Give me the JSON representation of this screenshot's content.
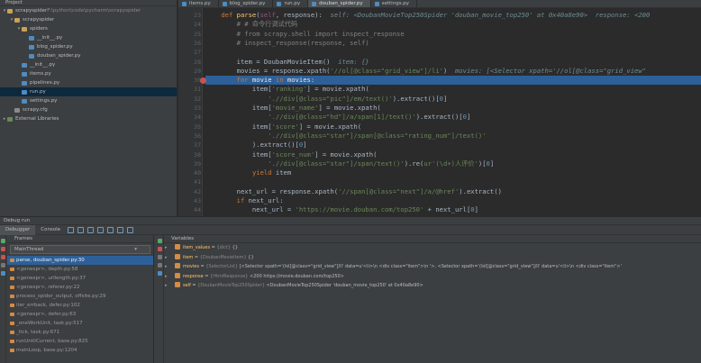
{
  "project": {
    "header": "Project",
    "tree": [
      {
        "label": "scrapyspider",
        "suffix": " F:\\python\\code\\pycharm\\scrapyspider",
        "kind": "folder",
        "indent": 0,
        "arrow": "▾"
      },
      {
        "label": "scrapyspider",
        "kind": "folder",
        "indent": 1,
        "arrow": "▾"
      },
      {
        "label": "spiders",
        "kind": "folder",
        "indent": 2,
        "arrow": "▾"
      },
      {
        "label": "__init__.py",
        "kind": "py",
        "indent": 3,
        "arrow": ""
      },
      {
        "label": "blog_spider.py",
        "kind": "py",
        "indent": 3,
        "arrow": ""
      },
      {
        "label": "douban_spider.py",
        "kind": "py",
        "indent": 3,
        "arrow": ""
      },
      {
        "label": "__init__.py",
        "kind": "py",
        "indent": 2,
        "arrow": ""
      },
      {
        "label": "items.py",
        "kind": "py",
        "indent": 2,
        "arrow": ""
      },
      {
        "label": "pipelines.py",
        "kind": "py",
        "indent": 2,
        "arrow": ""
      },
      {
        "label": "run.py",
        "kind": "py",
        "indent": 2,
        "arrow": "",
        "selected": true
      },
      {
        "label": "settings.py",
        "kind": "py",
        "indent": 2,
        "arrow": ""
      },
      {
        "label": "scrapy.cfg",
        "kind": "cfg",
        "indent": 1,
        "arrow": ""
      },
      {
        "label": "External Libraries",
        "kind": "lib",
        "indent": 0,
        "arrow": "▸"
      }
    ]
  },
  "editor": {
    "tabs": [
      {
        "label": "items.py"
      },
      {
        "label": "blog_spider.py"
      },
      {
        "label": "run.py"
      },
      {
        "label": "douban_spider.py",
        "active": true
      },
      {
        "label": "settings.py"
      }
    ],
    "highlight_line": 30,
    "breakpoint_line": 30,
    "lines": [
      {
        "n": "23",
        "html": "    <span class=\"kw\">def</span> <span class=\"fn\">parse</span>(<span class=\"sf\">self</span>, response):  <span class=\"inl\">self: &lt;DoubanMovieTop250Spider 'douban_movie_top250' at 0x40a8e90&gt;  response: &lt;200</span>"
      },
      {
        "n": "24",
        "html": "        <span class=\"cm\"># # 命令行调试代码</span>"
      },
      {
        "n": "25",
        "html": "        <span class=\"cm\"># from scrapy.shell import inspect_response</span>"
      },
      {
        "n": "26",
        "html": "        <span class=\"cm\"># inspect_response(response, self)</span>"
      },
      {
        "n": "27",
        "html": ""
      },
      {
        "n": "28",
        "html": "        item = DoubanMovieItem()  <span class=\"inl\">item: {}</span>"
      },
      {
        "n": "29",
        "html": "        movies = response.xpath(<span class=\"st\">'//ol[@class=\"grid_view\"]/li'</span>)  <span class=\"inl\">movies: [&lt;Selector xpath='//ol[@class=\"grid_view\"</span>"
      },
      {
        "n": "30",
        "html": "        <span class=\"kw\">for</span> movie <span class=\"kw\">in</span> movies:"
      },
      {
        "n": "31",
        "html": "            item[<span class=\"st\">'ranking'</span>] = movie.xpath("
      },
      {
        "n": "32",
        "html": "                <span class=\"st\">'.//div[@class=\"pic\"]/em/text()'</span>).extract()[<span class=\"nm\">0</span>]"
      },
      {
        "n": "33",
        "html": "            item[<span class=\"st\">'movie_name'</span>] = movie.xpath("
      },
      {
        "n": "34",
        "html": "                <span class=\"st\">'.//div[@class=\"hd\"]/a/span[1]/text()'</span>).extract()[<span class=\"nm\">0</span>]"
      },
      {
        "n": "35",
        "html": "            item[<span class=\"st\">'score'</span>] = movie.xpath("
      },
      {
        "n": "36",
        "html": "                <span class=\"st\">'.//div[@class=\"star\"]/span[@class=\"rating_num\"]/text()'</span>"
      },
      {
        "n": "37",
        "html": "            ).extract()[<span class=\"nm\">0</span>]"
      },
      {
        "n": "38",
        "html": "            item[<span class=\"st\">'score_num'</span>] = movie.xpath("
      },
      {
        "n": "39",
        "html": "                <span class=\"st\">'.//div[@class=\"star\"]/span/text()'</span>).re(<span class=\"st\">ur'(\\d+)人评价'</span>)[<span class=\"nm\">0</span>]"
      },
      {
        "n": "40",
        "html": "            <span class=\"kw\">yield</span> item"
      },
      {
        "n": "41",
        "html": ""
      },
      {
        "n": "42",
        "html": "        next_url = response.xpath(<span class=\"st\">'//span[@class=\"next\"]/a/@href'</span>).extract()"
      },
      {
        "n": "43",
        "html": "        <span class=\"kw\">if</span> next_url:"
      },
      {
        "n": "44",
        "html": "            next_url = <span class=\"st\">'https://movie.douban.com/top250'</span> + next_url[<span class=\"nm\">0</span>]"
      }
    ]
  },
  "debug": {
    "header": "Debug   run",
    "tabs": [
      {
        "label": "Debugger",
        "active": true
      },
      {
        "label": "Console"
      }
    ],
    "frames_title": "Frames",
    "variables_title": "Variables",
    "thread": "MainThread",
    "frames": [
      {
        "label": "parse, douban_spider.py:30",
        "selected": true
      },
      {
        "label": "<genexpr>, depth.py:58"
      },
      {
        "label": "<genexpr>, urllength.py:37"
      },
      {
        "label": "<genexpr>, referer.py:22"
      },
      {
        "label": "process_spider_output, offsite.py:29"
      },
      {
        "label": "iter_errback, defer.py:102"
      },
      {
        "label": "<genexpr>, defer.py:63"
      },
      {
        "label": "_oneWorkUnit, task.py:517"
      },
      {
        "label": "_tick, task.py:671"
      },
      {
        "label": "runUntilCurrent, base.py:825"
      },
      {
        "label": "mainLoop, base.py:1204"
      }
    ],
    "variables": [
      {
        "name": "item_values",
        "type": "{dict}",
        "value": "{}"
      },
      {
        "name": "item",
        "type": "{DoubanMovieItem}",
        "value": "{}"
      },
      {
        "name": "movies",
        "type": "{SelectorList}",
        "value": "[<Selector xpath='//ol[@class=\"grid_view\"]/li' data=u'<li>\\n            <div class=\"item\">\\n    '>, <Selector xpath='//ol[@class=\"grid_view\"]/li' data=u'<li>\\n            <div class=\"item\">'"
      },
      {
        "name": "response",
        "type": "{HtmlResponse}",
        "value": "<200 https://movie.douban.com/top250>"
      },
      {
        "name": "self",
        "type": "{DoubanMovieTop250Spider}",
        "value": "<DoubanMovieTop250Spider 'douban_movie_top250' at 0x40a8e90>"
      }
    ]
  }
}
